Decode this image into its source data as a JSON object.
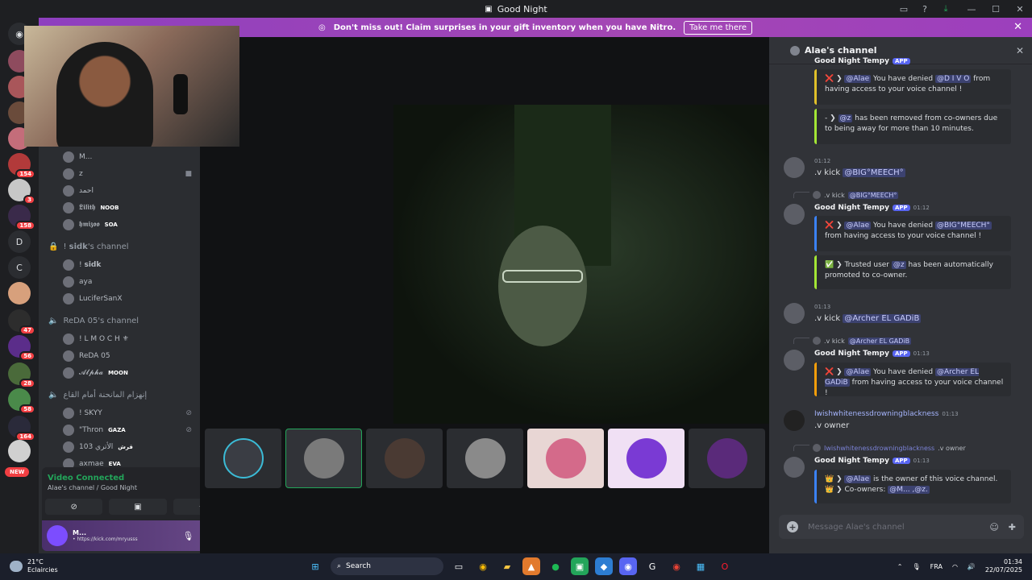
{
  "window": {
    "title": "Good Night"
  },
  "banner": {
    "text": "Don't miss out! Claim surprises in your gift inventory when you have Nitro.",
    "button": "Take me there"
  },
  "servers": {
    "letters": [
      "D",
      "C"
    ],
    "badges": [
      "154",
      "3",
      "158",
      "47",
      "56",
      "28",
      "58",
      "164"
    ],
    "new_label": "NEW"
  },
  "channels": {
    "users_top": [
      {
        "name": "M..."
      },
      {
        "name": "z"
      },
      {
        "name": "احمد"
      },
      {
        "name": "𝕷𝖎𝖑𝖎𝖙𝖍",
        "tag": "NOOB"
      },
      {
        "name": "𝖍𝖒𝖎𝖟𝖔𝖔",
        "tag": "SOA"
      }
    ],
    "channel_1": "! 𝘀𝗶𝗱𝗸's channel",
    "channel_1_users": [
      "! 𝘀𝗶𝗱𝗸",
      "aya",
      "LuciferSanX"
    ],
    "channel_2": "ReDA 05's channel",
    "channel_2_users": [
      {
        "name": "! L M O C H ⚜"
      },
      {
        "name": "ReDA 05"
      },
      {
        "name": "𝓐𝓵𝓹𝓱𝓪",
        "tag": "MOON"
      }
    ],
    "channel_3": "إنهزام المانحنة أمام القاع",
    "channel_3_users": [
      {
        "name": "! SKYY"
      },
      {
        "name": "\"Thron",
        "tag": "GAZA"
      },
      {
        "name": "الأتري 103",
        "tag": "قرش"
      },
      {
        "name": "axmae",
        "tag": "EVA"
      }
    ]
  },
  "voice": {
    "status": "Video Connected",
    "channel": "Alae's channel / Good Night",
    "user_name": "M...",
    "user_sub": "• https://kick.com/mryusss"
  },
  "chat": {
    "header": "Alae's channel",
    "top_name": "Good Night Tempy",
    "embed_1a": {
      "pre": "❌ ❯ ",
      "mention": "@Alae",
      "text": " You have denied ",
      "mention2": "@D I V O",
      "post": " from having access to your voice channel !"
    },
    "embed_1b": {
      "pre": "- ❯ ",
      "mention": "@z",
      "text": " has been removed from co-owners due to being away for more than 10 minutes."
    },
    "msg_1_time": "01:12",
    "msg_1_text": ".v kick ",
    "msg_1_mention": "@BIG°MEECH°",
    "reply_1": ".v kick ",
    "reply_1_mention": "@BIG°MEECH°",
    "bot_name": "Good Night Tempy",
    "app_label": "APP",
    "bot_time_1": "01:12",
    "embed_2a": {
      "pre": "❌ ❯ ",
      "mention": "@Alae",
      "text": " You have denied ",
      "mention2": "@BIG°MEECH°",
      "post": " from having access to your voice channel !"
    },
    "embed_2b": {
      "pre": "✅ ❯ Trusted user ",
      "mention": "@z",
      "text": " has been automatically promoted to co-owner."
    },
    "msg_2_time": "01:13",
    "msg_2_text": ".v kick ",
    "msg_2_mention": "@Archer EL GADiB",
    "reply_2": ".v kick ",
    "reply_2_mention": "@Archer EL GADiB",
    "bot_time_2": "01:13",
    "embed_3a": {
      "pre": "❌ ❯ ",
      "mention": "@Alae",
      "text": " You have denied ",
      "mention2": "@Archer EL GADiB",
      "post": " from having access to your voice channel !"
    },
    "msg_3_user": "Iwishwhitenessdrowningblackness",
    "msg_3_time": "01:13",
    "msg_3_text": ".v owner",
    "reply_3_user": "Iwishwhitenessdrowningblackness",
    "reply_3": " .v owner",
    "bot_time_3": "01:13",
    "embed_4_line1_pre": "👑 ❯ ",
    "embed_4_line1_mention": "@Alae",
    "embed_4_line1_text": " is the owner of this voice channel.",
    "embed_4_line2_pre": "👑 ❯ Co-owners: ",
    "embed_4_line2_mentions": "@M... ,@z.",
    "composer_placeholder": "Message Alae's channel"
  },
  "taskbar": {
    "temp": "21°C",
    "weather": "Eclaircies",
    "search": "Search",
    "lang": "FRA",
    "time": "01:34",
    "date": "22/07/2025"
  }
}
